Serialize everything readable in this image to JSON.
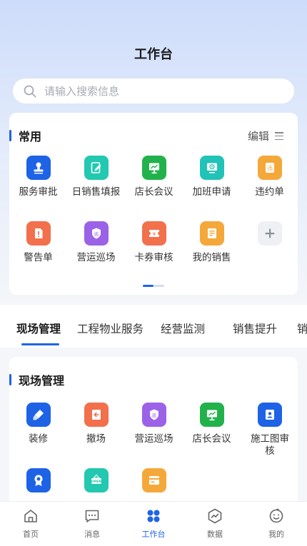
{
  "header": {
    "title": "工作台"
  },
  "search": {
    "placeholder": "请输入搜索信息"
  },
  "common": {
    "title": "常用",
    "edit_label": "编辑",
    "items": [
      {
        "label": "服务审批",
        "icon": "stamp-icon",
        "color": "#1e63e6"
      },
      {
        "label": "日销售填报",
        "icon": "edit-doc-icon",
        "color": "#22c8b0"
      },
      {
        "label": "店长会议",
        "icon": "presentation-icon",
        "color": "#22b24c"
      },
      {
        "label": "加班申请",
        "icon": "clock-screen-icon",
        "color": "#21c3b8"
      },
      {
        "label": "违约单",
        "icon": "violation-icon",
        "color": "#f5a83a"
      },
      {
        "label": "警告单",
        "icon": "warning-doc-icon",
        "color": "#f2704c"
      },
      {
        "label": "营运巡场",
        "icon": "patrol-shield-icon",
        "color": "#9b62e8"
      },
      {
        "label": "卡券审核",
        "icon": "coupon-icon",
        "color": "#f2704c"
      },
      {
        "label": "我的销售",
        "icon": "sales-doc-icon",
        "color": "#f5a83a"
      },
      {
        "label": "",
        "icon": "plus-icon",
        "color": "#eef0f4"
      }
    ]
  },
  "tabs": {
    "items": [
      "现场管理",
      "工程物业服务",
      "经营监测",
      "销售提升",
      "销"
    ],
    "active": 0
  },
  "field": {
    "title": "现场管理",
    "items": [
      {
        "label": "装修",
        "icon": "paint-brush-icon",
        "color": "#1e63e6"
      },
      {
        "label": "撤场",
        "icon": "exit-icon",
        "color": "#f2704c"
      },
      {
        "label": "营运巡场",
        "icon": "patrol-shield-icon",
        "color": "#9b62e8"
      },
      {
        "label": "店长会议",
        "icon": "presentation-icon",
        "color": "#22b24c"
      },
      {
        "label": "施工图审核",
        "icon": "blueprint-icon",
        "color": "#1e63e6"
      },
      {
        "label": "",
        "icon": "badge-icon",
        "color": "#1e63e6"
      },
      {
        "label": "",
        "icon": "open-sign-icon",
        "color": "#22c8b0"
      },
      {
        "label": "",
        "icon": "card-icon",
        "color": "#f5a83a"
      }
    ]
  },
  "bottom_nav": {
    "items": [
      {
        "label": "首页",
        "icon": "home-icon"
      },
      {
        "label": "消息",
        "icon": "message-icon"
      },
      {
        "label": "工作台",
        "icon": "grid-icon"
      },
      {
        "label": "数据",
        "icon": "chart-icon"
      },
      {
        "label": "我的",
        "icon": "user-icon"
      }
    ],
    "active": 2
  },
  "colors": {
    "accent": "#1f63e6"
  }
}
